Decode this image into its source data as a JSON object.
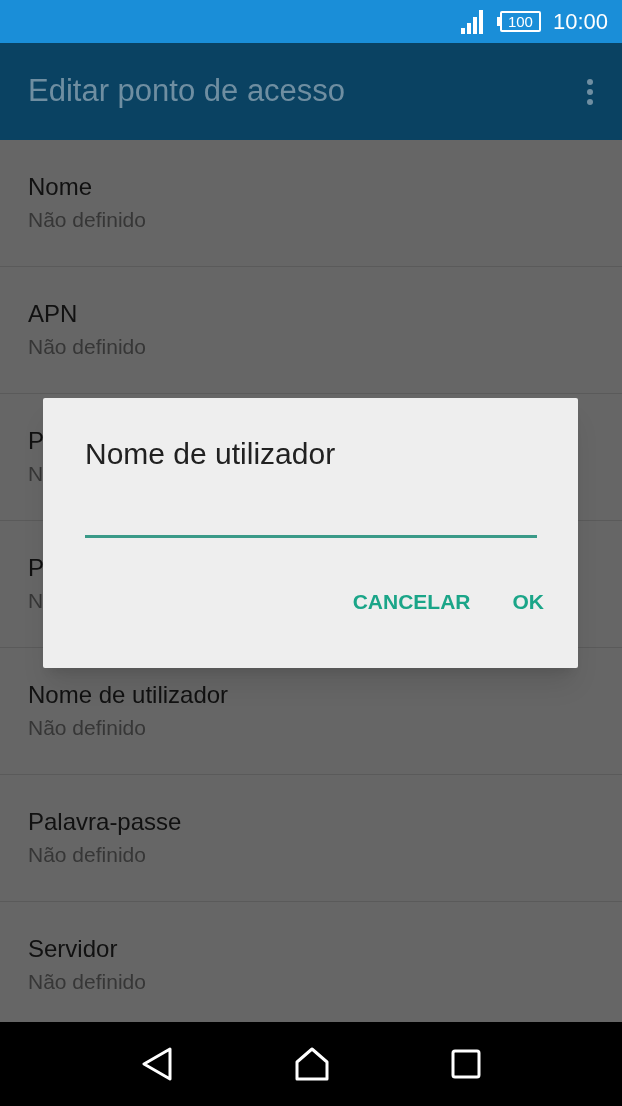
{
  "status_bar": {
    "battery": "100",
    "time": "10:00"
  },
  "app_bar": {
    "title": "Editar ponto de acesso"
  },
  "settings": [
    {
      "label": "Nome",
      "value": "Não definido"
    },
    {
      "label": "APN",
      "value": "Não definido"
    },
    {
      "label": "P",
      "value": "N"
    },
    {
      "label": "P",
      "value": "N"
    },
    {
      "label": "Nome de utilizador",
      "value": "Não definido"
    },
    {
      "label": "Palavra-passe",
      "value": "Não definido"
    },
    {
      "label": "Servidor",
      "value": "Não definido"
    }
  ],
  "dialog": {
    "title": "Nome de utilizador",
    "buttons": [
      "CANCELAR",
      "OK"
    ]
  }
}
